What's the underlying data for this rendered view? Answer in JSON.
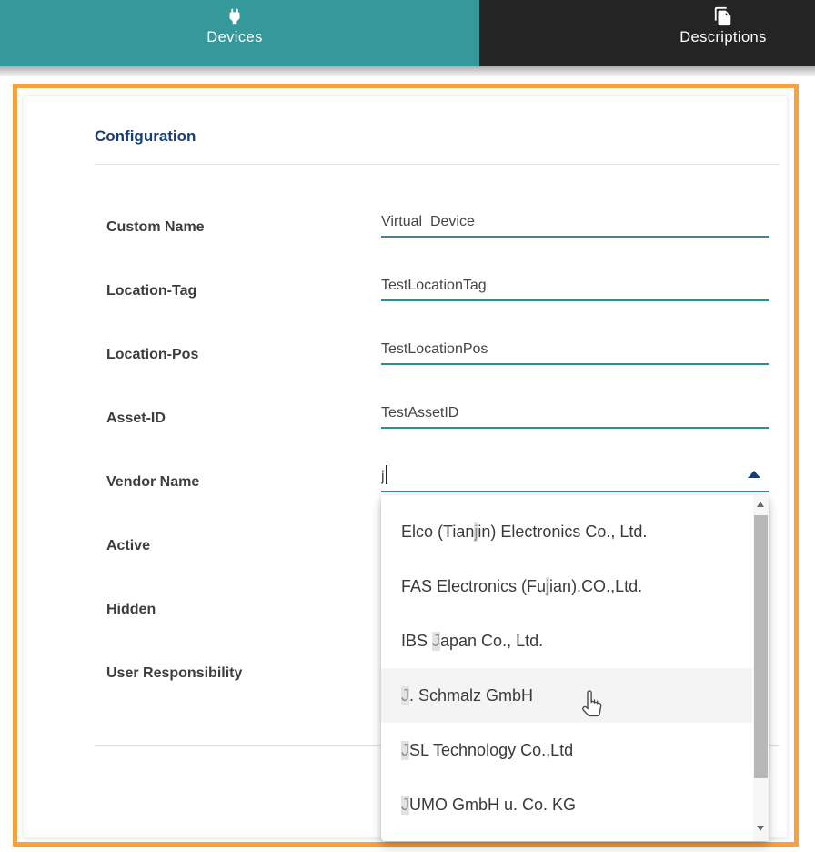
{
  "tabs": {
    "devices": {
      "label": "Devices",
      "icon": "plug-icon"
    },
    "descriptions": {
      "label": "Descriptions",
      "icon": "copy-pages-icon"
    }
  },
  "section": {
    "title": "Configuration"
  },
  "form": {
    "custom_name": {
      "label": "Custom Name",
      "value": "Virtual  Device"
    },
    "location_tag": {
      "label": "Location-Tag",
      "value": "TestLocationTag"
    },
    "location_pos": {
      "label": "Location-Pos",
      "value": "TestLocationPos"
    },
    "asset_id": {
      "label": "Asset-ID",
      "value": "TestAssetID"
    },
    "vendor_name": {
      "label": "Vendor Name",
      "value": "j"
    },
    "active": {
      "label": "Active"
    },
    "hidden": {
      "label": "Hidden"
    },
    "user_responsibility": {
      "label": "User Responsibility"
    }
  },
  "dropdown": {
    "hovered_item": "J. Schmalz GmbH",
    "items": [
      {
        "pre": "Elco (Tian",
        "match": "j",
        "post": "in) Electronics Co., Ltd."
      },
      {
        "pre": "FAS Electronics (Fu",
        "match": "j",
        "post": "ian).CO.,Ltd."
      },
      {
        "pre": "IBS ",
        "match": "J",
        "post": "apan Co., Ltd."
      },
      {
        "pre": "",
        "match": "J",
        "post": ". Schmalz GmbH"
      },
      {
        "pre": "",
        "match": "J",
        "post": "SL Technology Co.,Ltd"
      },
      {
        "pre": "",
        "match": "J",
        "post": "UMO GmbH u. Co. KG"
      }
    ]
  },
  "colors": {
    "teal": "#35989A",
    "dark": "#242424",
    "orange": "#F9A13A",
    "navy": "#1B3C74",
    "underline_teal": "#2E8F91",
    "match_highlight": "#E2E2E2"
  }
}
